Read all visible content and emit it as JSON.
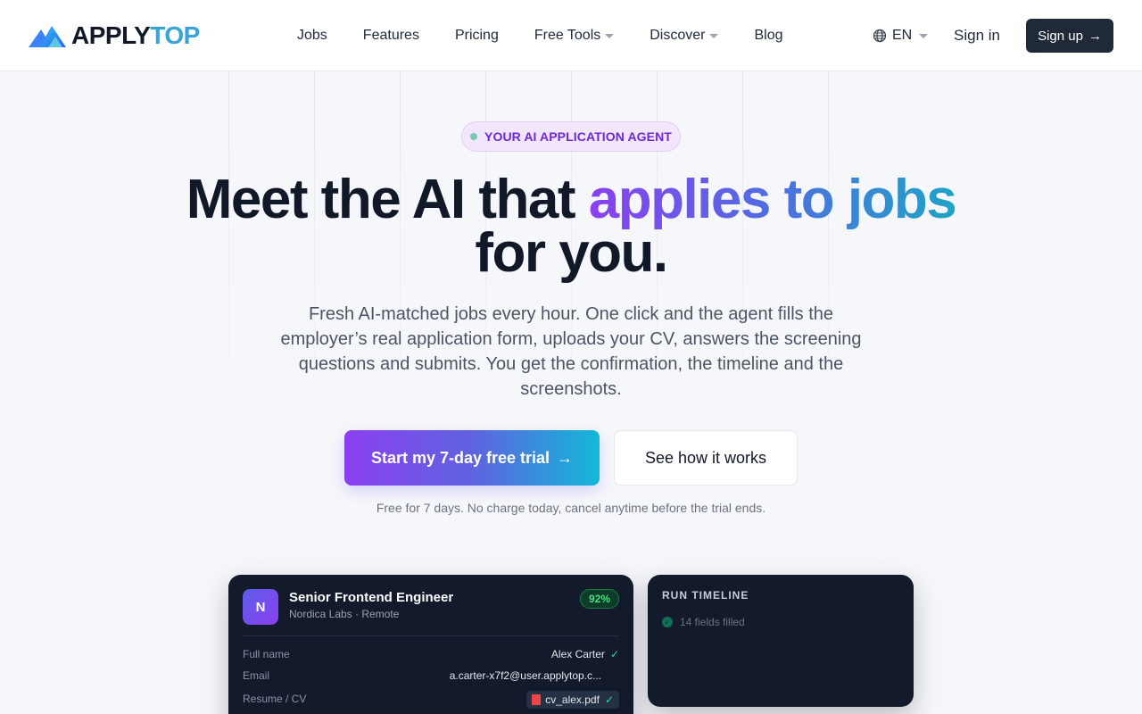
{
  "brand": {
    "name_part1": "APPLY",
    "name_part2": "TOP",
    "color_dark": "#111827",
    "color_accent": "#38a3d8"
  },
  "nav": {
    "items": [
      {
        "label": "Jobs",
        "dropdown": false
      },
      {
        "label": "Features",
        "dropdown": false
      },
      {
        "label": "Pricing",
        "dropdown": false
      },
      {
        "label": "Free Tools",
        "dropdown": true
      },
      {
        "label": "Discover",
        "dropdown": true
      },
      {
        "label": "Blog",
        "dropdown": false
      }
    ],
    "language": "EN",
    "sign_in": "Sign in",
    "sign_up": "Sign up"
  },
  "hero": {
    "badge": "YOUR AI APPLICATION AGENT",
    "headline_plain": "Meet the AI that",
    "headline_highlight": "applies to jobs",
    "headline_end": "for you.",
    "subtext": "Fresh AI-matched jobs every hour. One click and the agent fills the employer’s real application form, uploads your CV, answers the screening questions and submits. You get the confirmation, the timeline and the screenshots.",
    "cta_primary": "Start my 7-day free trial",
    "cta_secondary": "See how it works",
    "note": "Free for 7 days. No charge today, cancel anytime before the trial ends.",
    "gradient_colors": [
      "#8b3ff0",
      "#4f6ee0",
      "#1fa3c5"
    ]
  },
  "job_card": {
    "avatar_letter": "N",
    "title": "Senior Frontend Engineer",
    "subtitle": "Nordica Labs · Remote",
    "match": "92%",
    "fields": [
      {
        "label": "Full name",
        "value": "Alex Carter",
        "checked": true
      },
      {
        "label": "Email",
        "value": "a.carter-x7f2@user.applytop.c...",
        "checked": false
      },
      {
        "label": "Resume / CV",
        "value": "cv_alex.pdf",
        "checked": true,
        "file": true
      }
    ]
  },
  "timeline_card": {
    "title": "RUN TIMELINE",
    "items": [
      {
        "label": "14 fields filled"
      }
    ]
  }
}
